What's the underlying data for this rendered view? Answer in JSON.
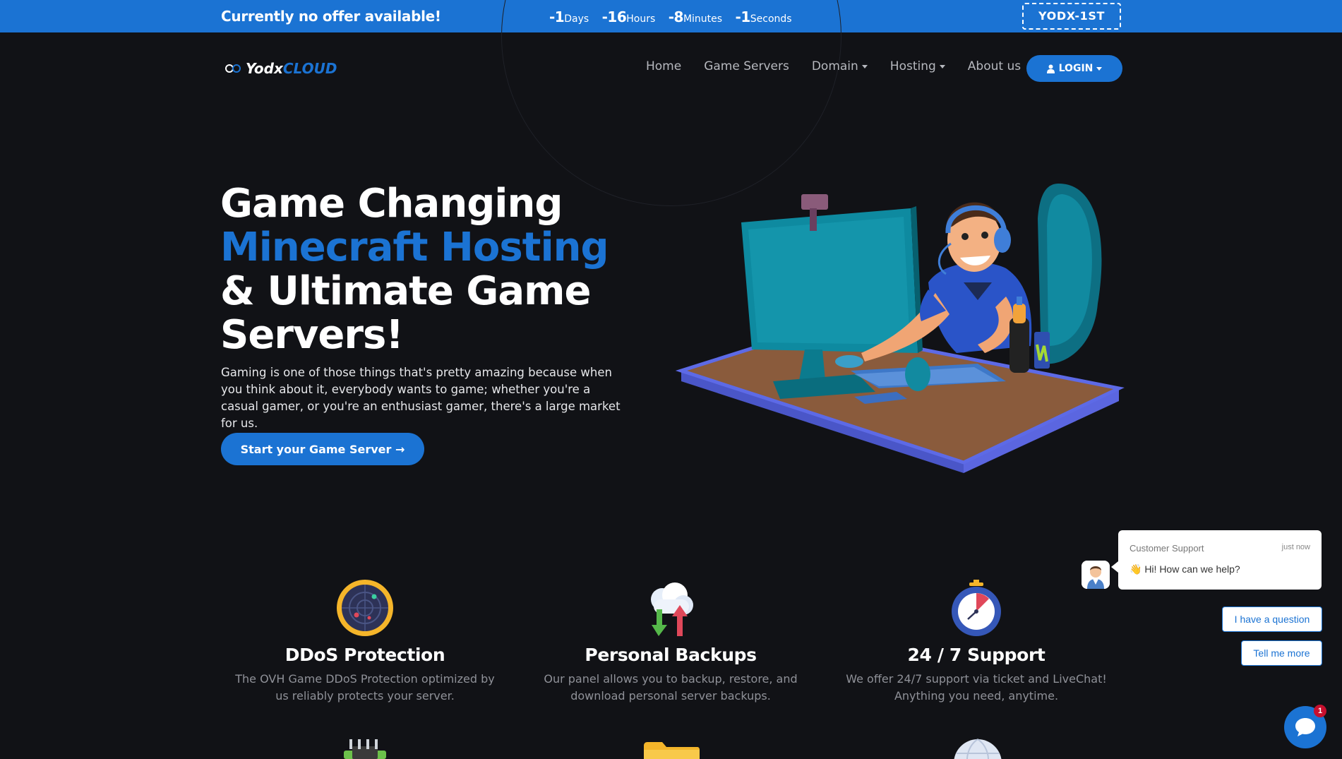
{
  "promo": {
    "text": "Currently no offer available!",
    "countdown": [
      {
        "value": "-1",
        "unit": "Days"
      },
      {
        "value": "-16",
        "unit": "Hours"
      },
      {
        "value": "-8",
        "unit": "Minutes"
      },
      {
        "value": "-1",
        "unit": "Seconds"
      }
    ],
    "coupon_code": "YODX-1ST"
  },
  "brand": {
    "name_part1": "Yodx",
    "name_part2": "CLOUD",
    "accent_color": "#1b73d3"
  },
  "nav": {
    "items": [
      {
        "label": "Home",
        "dropdown": false
      },
      {
        "label": "Game Servers",
        "dropdown": false
      },
      {
        "label": "Domain",
        "dropdown": true
      },
      {
        "label": "Hosting",
        "dropdown": true
      },
      {
        "label": "About us",
        "dropdown": false
      }
    ],
    "login_label": "LOGIN"
  },
  "hero": {
    "title_line1": "Game Changing",
    "title_line2": "Minecraft Hosting",
    "title_line3": "& Ultimate Game",
    "title_line4": "Servers!",
    "description": "Gaming is one of those things that's pretty amazing because when you think about it, everybody wants to game; whether you're a casual gamer, or you're an enthusiast gamer, there's a large market for us.",
    "cta_label": "Start your Game Server →"
  },
  "features": [
    {
      "title": "DDoS Protection",
      "text": "The OVH Game DDoS Protection optimized by us reliably protects your server.",
      "icon": "radar-icon"
    },
    {
      "title": "Personal Backups",
      "text": "Our panel allows you to backup, restore, and download personal server backups.",
      "icon": "cloud-sync-icon"
    },
    {
      "title": "24 / 7 Support",
      "text": "We offer 24/7 support via ticket and LiveChat! Anything you need, anytime.",
      "icon": "stopwatch-icon"
    }
  ],
  "chat": {
    "agent": "Customer Support",
    "time": "just now",
    "message": "👋 Hi! How can we help?",
    "quick_replies": [
      "I have a question",
      "Tell me more"
    ],
    "unread_count": "1"
  }
}
